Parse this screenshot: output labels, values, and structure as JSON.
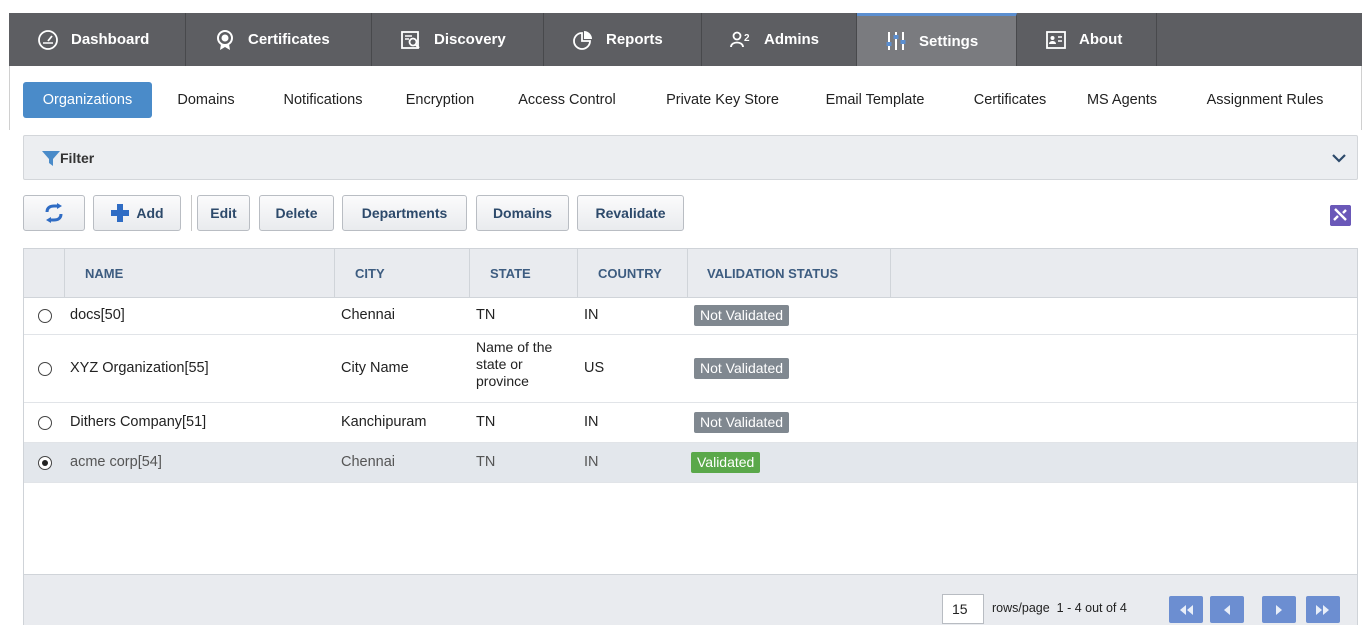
{
  "nav": {
    "tabs": [
      {
        "label": "Dashboard",
        "icon": "gauge-icon"
      },
      {
        "label": "Certificates",
        "icon": "certificate-icon"
      },
      {
        "label": "Discovery",
        "icon": "discovery-icon"
      },
      {
        "label": "Reports",
        "icon": "reports-icon"
      },
      {
        "label": "Admins",
        "icon": "admins-icon"
      },
      {
        "label": "Settings",
        "icon": "settings-icon"
      },
      {
        "label": "About",
        "icon": "about-icon"
      }
    ],
    "active": "Settings"
  },
  "subtabs": {
    "items": [
      "Organizations",
      "Domains",
      "Notifications",
      "Encryption",
      "Access Control",
      "Private Key Store",
      "Email Template",
      "Certificates",
      "MS Agents",
      "Assignment Rules"
    ],
    "active": "Organizations"
  },
  "filter": {
    "label": "Filter"
  },
  "toolbar": {
    "refresh_icon": "refresh-icon",
    "add_label": "Add",
    "edit_label": "Edit",
    "delete_label": "Delete",
    "departments_label": "Departments",
    "domains_label": "Domains",
    "revalidate_label": "Revalidate"
  },
  "grid": {
    "columns": [
      "NAME",
      "CITY",
      "STATE",
      "COUNTRY",
      "VALIDATION STATUS"
    ],
    "rows": [
      {
        "name": "docs[50]",
        "city": "Chennai",
        "state": "TN",
        "country": "IN",
        "status": "Not Validated",
        "selected": false
      },
      {
        "name": "XYZ Organization[55]",
        "city": "City Name",
        "state": "Name of the state or province",
        "country": "US",
        "status": "Not Validated",
        "selected": false
      },
      {
        "name": "Dithers Company[51]",
        "city": "Kanchipuram",
        "state": "TN",
        "country": "IN",
        "status": "Not Validated",
        "selected": false
      },
      {
        "name": "acme corp[54]",
        "city": "Chennai",
        "state": "TN",
        "country": "IN",
        "status": "Validated",
        "selected": true
      }
    ]
  },
  "pager": {
    "rows_per_page": "15",
    "rows_label": "rows/page",
    "range": "1 - 4 out of 4"
  },
  "colors": {
    "nav_bg": "#5d5e62",
    "accent": "#4a8bc9",
    "validated": "#5aa84a",
    "not_validated": "#808890"
  }
}
